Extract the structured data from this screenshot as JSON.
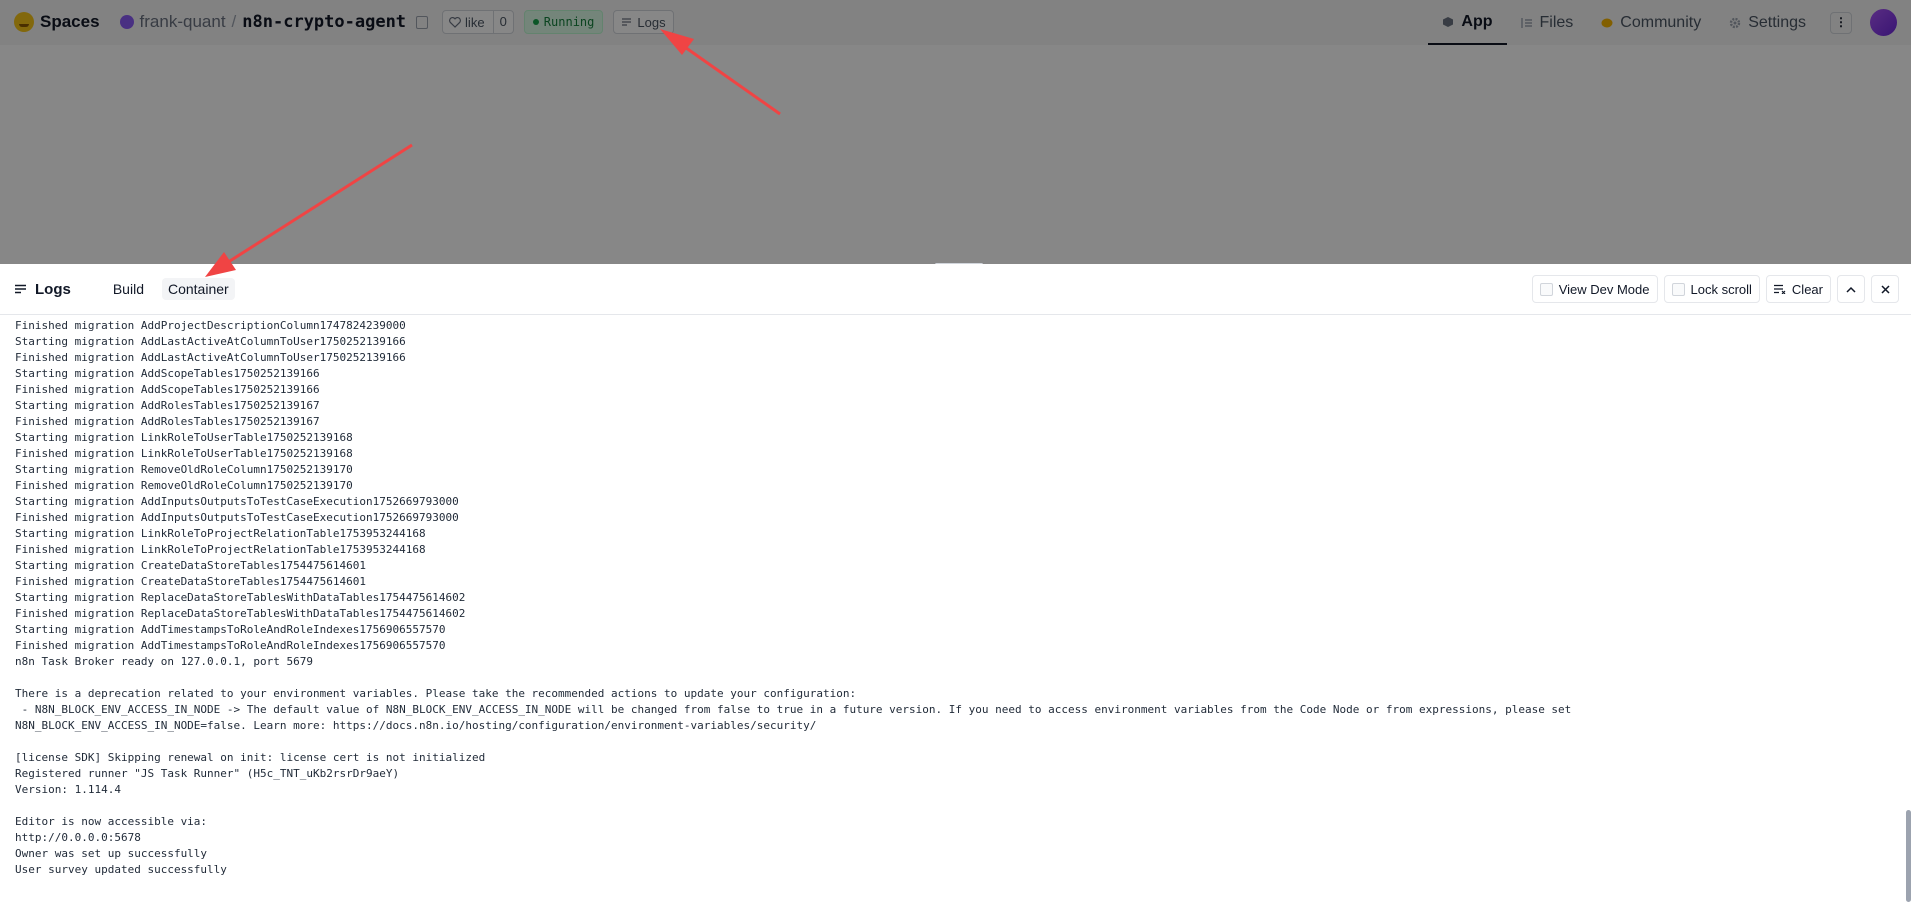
{
  "header": {
    "brand": "Spaces",
    "owner": "frank-quant",
    "separator": "/",
    "repo": "n8n-crypto-agent",
    "like_label": "like",
    "like_count": "0",
    "status": "Running",
    "logs_label": "Logs",
    "nav": [
      {
        "label": "App",
        "icon": "cube-icon",
        "active": true
      },
      {
        "label": "Files",
        "icon": "files-icon"
      },
      {
        "label": "Community",
        "icon": "community-icon"
      },
      {
        "label": "Settings",
        "icon": "gear-icon"
      }
    ],
    "more_label": "⋮"
  },
  "logs_panel": {
    "title": "Logs",
    "tabs": [
      "Build",
      "Container"
    ],
    "active_tab": "Container",
    "view_dev_mode": "View Dev Mode",
    "lock_scroll": "Lock scroll",
    "clear": "Clear",
    "lines": [
      "Finished migration AddProjectDescriptionColumn1747824239000",
      "Starting migration AddLastActiveAtColumnToUser1750252139166",
      "Finished migration AddLastActiveAtColumnToUser1750252139166",
      "Starting migration AddScopeTables1750252139166",
      "Finished migration AddScopeTables1750252139166",
      "Starting migration AddRolesTables1750252139167",
      "Finished migration AddRolesTables1750252139167",
      "Starting migration LinkRoleToUserTable1750252139168",
      "Finished migration LinkRoleToUserTable1750252139168",
      "Starting migration RemoveOldRoleColumn1750252139170",
      "Finished migration RemoveOldRoleColumn1750252139170",
      "Starting migration AddInputsOutputsToTestCaseExecution1752669793000",
      "Finished migration AddInputsOutputsToTestCaseExecution1752669793000",
      "Starting migration LinkRoleToProjectRelationTable1753953244168",
      "Finished migration LinkRoleToProjectRelationTable1753953244168",
      "Starting migration CreateDataStoreTables1754475614601",
      "Finished migration CreateDataStoreTables1754475614601",
      "Starting migration ReplaceDataStoreTablesWithDataTables1754475614602",
      "Finished migration ReplaceDataStoreTablesWithDataTables1754475614602",
      "Starting migration AddTimestampsToRoleAndRoleIndexes1756906557570",
      "Finished migration AddTimestampsToRoleAndRoleIndexes1756906557570",
      "n8n Task Broker ready on 127.0.0.1, port 5679",
      "",
      "There is a deprecation related to your environment variables. Please take the recommended actions to update your configuration:",
      " - N8N_BLOCK_ENV_ACCESS_IN_NODE -> The default value of N8N_BLOCK_ENV_ACCESS_IN_NODE will be changed from false to true in a future version. If you need to access environment variables from the Code Node or from expressions, please set",
      "N8N_BLOCK_ENV_ACCESS_IN_NODE=false. Learn more: https://docs.n8n.io/hosting/configuration/environment-variables/security/",
      "",
      "[license SDK] Skipping renewal on init: license cert is not initialized",
      "Registered runner \"JS Task Runner\" (H5c_TNT_uKb2rsrDr9aeY)",
      "Version: 1.114.4",
      "",
      "Editor is now accessible via:",
      "http://0.0.0.0:5678",
      "Owner was set up successfully",
      "User survey updated successfully"
    ]
  },
  "colors": {
    "annotation_arrow": "#f04444",
    "status_green": "#16a34a",
    "overlay": "rgba(0,0,0,0.47)"
  }
}
